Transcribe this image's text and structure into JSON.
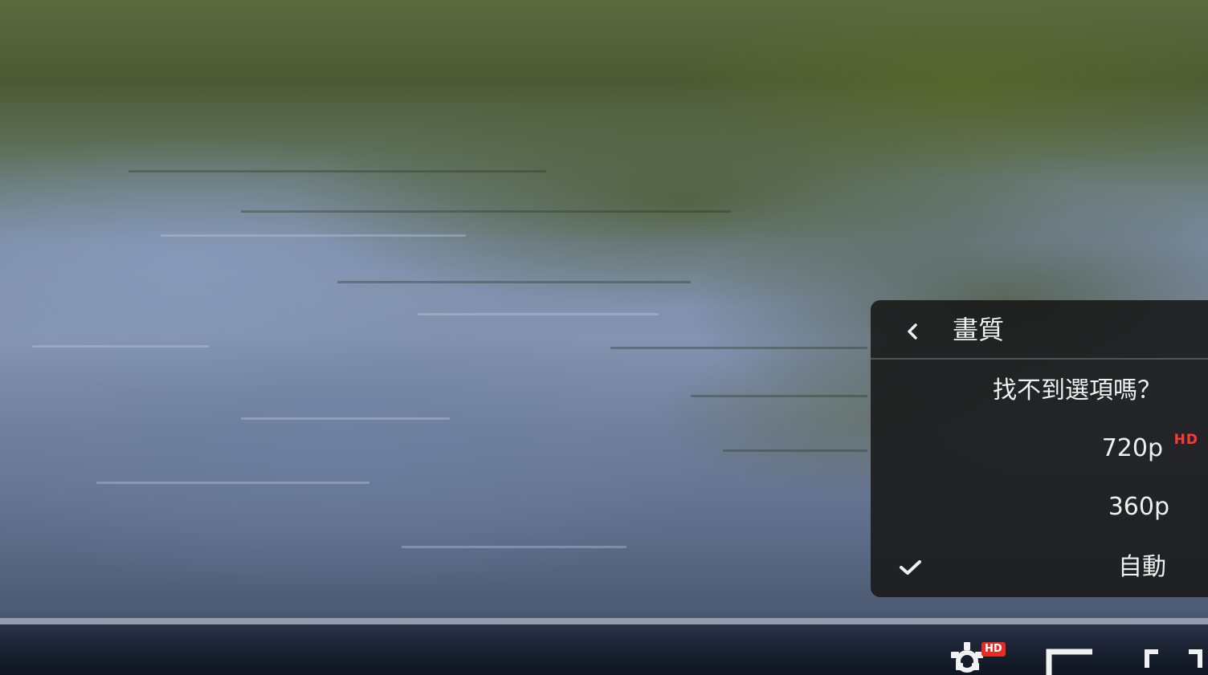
{
  "player": {
    "progress_fraction": 0.0,
    "accent_color": "#e52d27"
  },
  "quality_menu": {
    "title": "畫質",
    "help_label": "找不到選項嗎？",
    "options": [
      {
        "label": "720p",
        "badge": "HD",
        "selected": false
      },
      {
        "label": "360p",
        "badge": "",
        "selected": false
      },
      {
        "label": "自動",
        "badge": "",
        "selected": true
      }
    ]
  },
  "controls": {
    "settings_badge": "HD",
    "icons": [
      "gear-icon",
      "miniplayer-icon",
      "fullscreen-icon"
    ]
  }
}
